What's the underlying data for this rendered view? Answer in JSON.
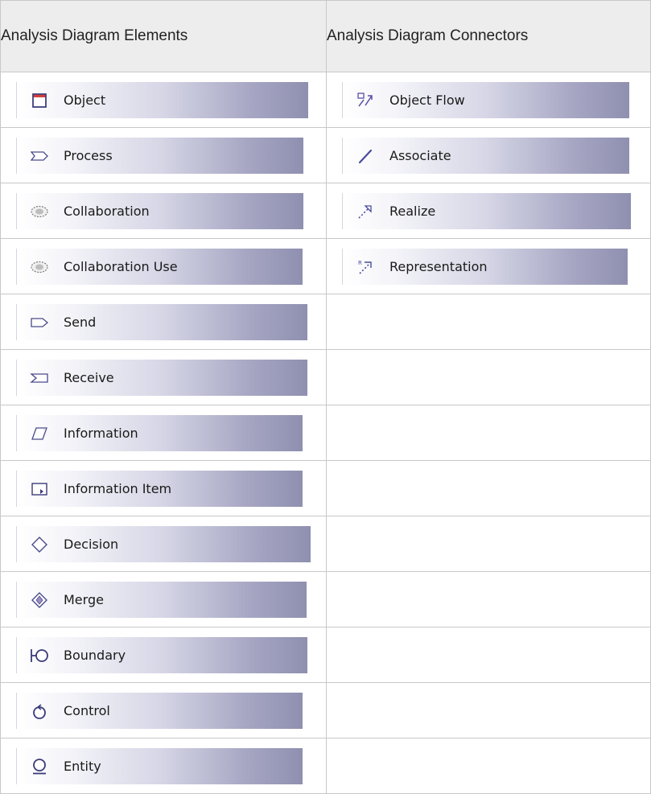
{
  "headers": {
    "elements": "Analysis Diagram Elements",
    "connectors": "Analysis Diagram Connectors"
  },
  "elements": [
    {
      "label": "Object",
      "icon": "object-icon"
    },
    {
      "label": "Process",
      "icon": "process-icon"
    },
    {
      "label": "Collaboration",
      "icon": "collaboration-icon"
    },
    {
      "label": "Collaboration Use",
      "icon": "collaboration-use-icon"
    },
    {
      "label": "Send",
      "icon": "send-icon"
    },
    {
      "label": "Receive",
      "icon": "receive-icon"
    },
    {
      "label": "Information",
      "icon": "information-icon"
    },
    {
      "label": "Information Item",
      "icon": "information-item-icon"
    },
    {
      "label": "Decision",
      "icon": "decision-icon"
    },
    {
      "label": "Merge",
      "icon": "merge-icon"
    },
    {
      "label": "Boundary",
      "icon": "boundary-icon"
    },
    {
      "label": "Control",
      "icon": "control-icon"
    },
    {
      "label": "Entity",
      "icon": "entity-icon"
    }
  ],
  "connectors": [
    {
      "label": "Object Flow",
      "icon": "object-flow-icon"
    },
    {
      "label": "Associate",
      "icon": "associate-icon"
    },
    {
      "label": "Realize",
      "icon": "realize-icon"
    },
    {
      "label": "Representation",
      "icon": "representation-icon"
    }
  ]
}
